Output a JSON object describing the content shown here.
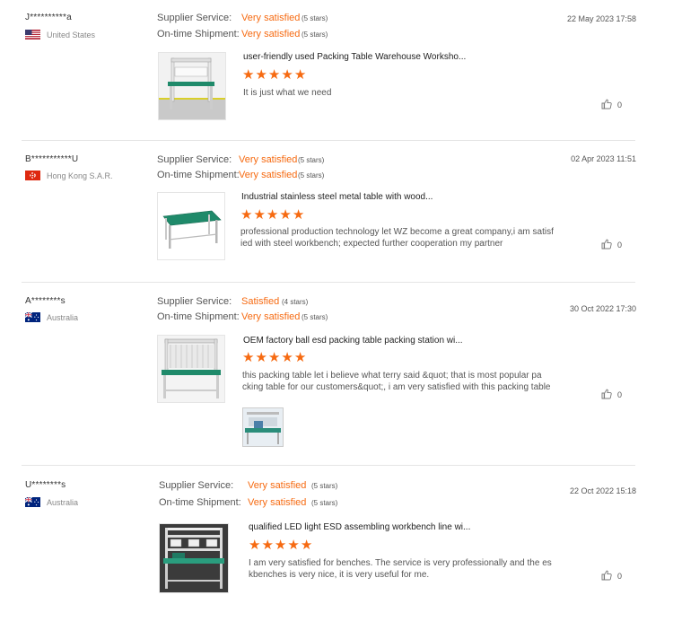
{
  "reviews": [
    {
      "user": "J**********a",
      "country": "United States",
      "flag": "flag-us-icon",
      "supplier_label": "Supplier Service:",
      "supplier_rating": "Very satisfied",
      "supplier_stars": "(5 stars)",
      "shipment_label": "On-time Shipment:",
      "shipment_rating": "Very satisfied",
      "shipment_stars": "(5 stars)",
      "date": "22 May 2023 17:58",
      "product_title": "user-friendly used Packing Table Warehouse Worksho...",
      "star_count": 5,
      "text": "It is just what we need",
      "likes": "0"
    },
    {
      "user": "B***********U",
      "country": "Hong Kong S.A.R.",
      "flag": "flag-hk-icon",
      "supplier_label": "Supplier Service:",
      "supplier_rating": "Very satisfied",
      "supplier_stars": "(5 stars)",
      "shipment_label": "On-time Shipment:",
      "shipment_rating": "Very satisfied",
      "shipment_stars": "(5 stars)",
      "date": "02 Apr 2023 11:51",
      "product_title": "Industrial stainless steel metal table with wood...",
      "star_count": 5,
      "text": "professional production technology let  WZ  become a great company,i am satisf\nied with steel workbench; expected further cooperation my partner",
      "likes": "0"
    },
    {
      "user": "A********s",
      "country": "Australia",
      "flag": "flag-au-icon",
      "supplier_label": "Supplier Service:",
      "supplier_rating": "Satisfied",
      "supplier_stars": "(4 stars)",
      "shipment_label": "On-time Shipment:",
      "shipment_rating": "Very satisfied",
      "shipment_stars": "(5 stars)",
      "date": "30 Oct 2022 17:30",
      "product_title": "OEM factory ball esd packing table packing station wi...",
      "star_count": 5,
      "text": "this packing table let i believe what terry said &quot; that is most popular pa\ncking table for our customers&quot;, i am very satisfied with this packing table",
      "likes": "0"
    },
    {
      "user": "U********s",
      "country": "Australia",
      "flag": "flag-au-icon",
      "supplier_label": "Supplier Service:",
      "supplier_rating": "Very satisfied",
      "supplier_stars": "(5 stars)",
      "shipment_label": "On-time Shipment:",
      "shipment_rating": "Very satisfied",
      "shipment_stars": "(5 stars)",
      "date": "22 Oct 2022 15:18",
      "product_title": "qualified LED light ESD assembling workbench line wi...",
      "star_count": 5,
      "text": "I am very satisfied for benches. The service is very professionally and the es\nkbenches is very nice, it is very useful for me.",
      "likes": "0"
    }
  ],
  "colors": {
    "accent": "#f66a11",
    "divider": "#e5e5e5",
    "bench_top": "#1f8a6a"
  }
}
